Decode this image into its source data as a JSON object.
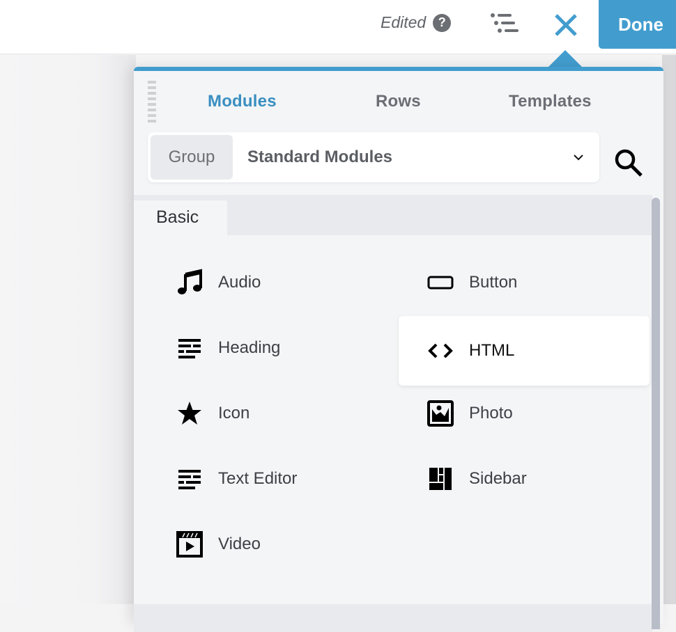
{
  "header": {
    "status_text": "Edited",
    "help_icon": "question-circle-icon",
    "outline_icon": "outline-list-icon",
    "close_icon": "close-x-icon",
    "done_label": "Done",
    "accent_color": "#429dce"
  },
  "panel": {
    "tabs": [
      {
        "label": "Modules",
        "active": true
      },
      {
        "label": "Rows",
        "active": false
      },
      {
        "label": "Templates",
        "active": false
      }
    ],
    "group_select": {
      "label": "Group",
      "value": "Standard Modules"
    },
    "search_icon": "search-icon",
    "category": "Basic",
    "modules": [
      {
        "label": "Audio",
        "icon": "music-note-icon"
      },
      {
        "label": "Button",
        "icon": "button-icon"
      },
      {
        "label": "Heading",
        "icon": "heading-icon"
      },
      {
        "label": "HTML",
        "icon": "code-icon",
        "hovered": true
      },
      {
        "label": "Icon",
        "icon": "star-icon"
      },
      {
        "label": "Photo",
        "icon": "photo-icon"
      },
      {
        "label": "Text Editor",
        "icon": "text-editor-icon"
      },
      {
        "label": "Sidebar",
        "icon": "sidebar-icon"
      },
      {
        "label": "Video",
        "icon": "video-icon"
      }
    ]
  }
}
